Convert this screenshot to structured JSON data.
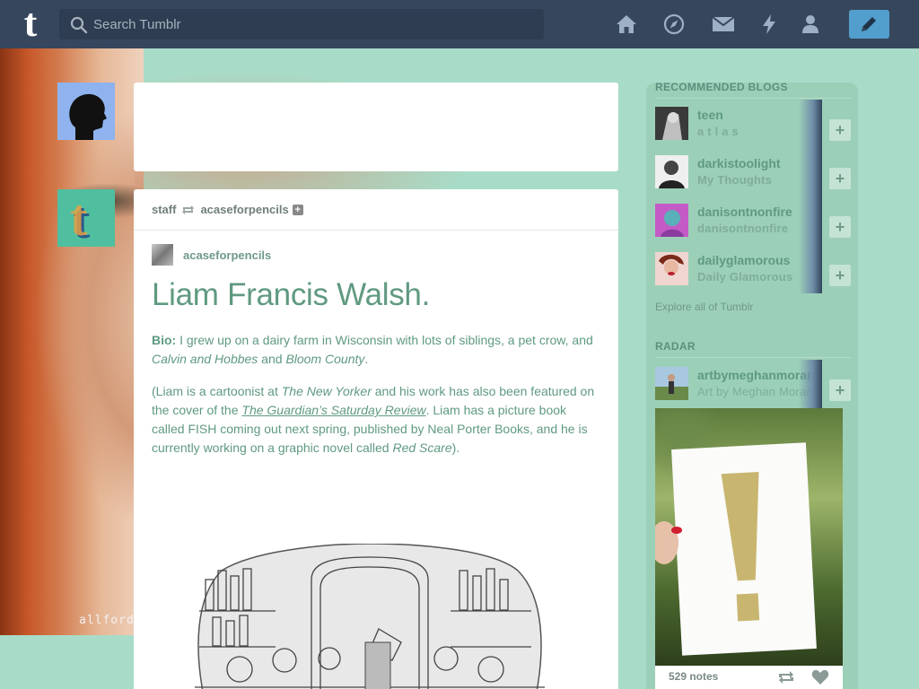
{
  "header": {
    "search_placeholder": "Search Tumblr",
    "nav": [
      "home-icon",
      "explore-icon",
      "inbox-icon",
      "activity-icon",
      "account-icon"
    ],
    "compose": "pencil-icon"
  },
  "background": {
    "watermark": "allforda"
  },
  "post": {
    "reblogged_by": "staff",
    "reblogged_from": "acaseforpencils",
    "follow_symbol": "+",
    "source_blog": "acaseforpencils",
    "title": "Liam Francis Walsh.",
    "bio_label": "Bio:",
    "bio_text_1": " I grew up on a dairy farm in Wisconsin with lots of siblings, a pet crow, and ",
    "bio_italic_1": "Calvin and Hobbes",
    "bio_text_2": " and ",
    "bio_italic_2": "Bloom County",
    "bio_text_3": ".",
    "p2_text_1": "(Liam is a cartoonist at ",
    "p2_italic_1": "The New Yorker",
    "p2_text_2": " and his work has also been featured on the cover of the ",
    "p2_link": "The Guardian’s Saturday Review",
    "p2_text_3": ". Liam has a picture book called FISH coming out next spring, published by Neal Porter Books, and he is currently working on a graphic novel called ",
    "p2_italic_2": "Red Scare",
    "p2_text_4": ")."
  },
  "sidebar": {
    "recommended_heading": "RECOMMENDED BLOGS",
    "recommended": [
      {
        "name": "teen",
        "desc": "a t l a s"
      },
      {
        "name": "darkistoolight",
        "desc": "My Thoughts"
      },
      {
        "name": "danisontnonfire",
        "desc": "danisontnonfire"
      },
      {
        "name": "dailyglamorous",
        "desc": "Daily Glamorous"
      }
    ],
    "follow_symbol": "+",
    "explore_link": "Explore all of Tumblr",
    "radar_heading": "RADAR",
    "radar_blog": {
      "name": "artbymeghanmoran",
      "desc": "Art by Meghan Moran"
    },
    "radar_notes": "529 notes"
  },
  "colors": {
    "header_bg": "#36465d",
    "compose_bg": "#529ecc",
    "page_bg": "#a8dcc8",
    "accent_text": "#5f9a80"
  }
}
